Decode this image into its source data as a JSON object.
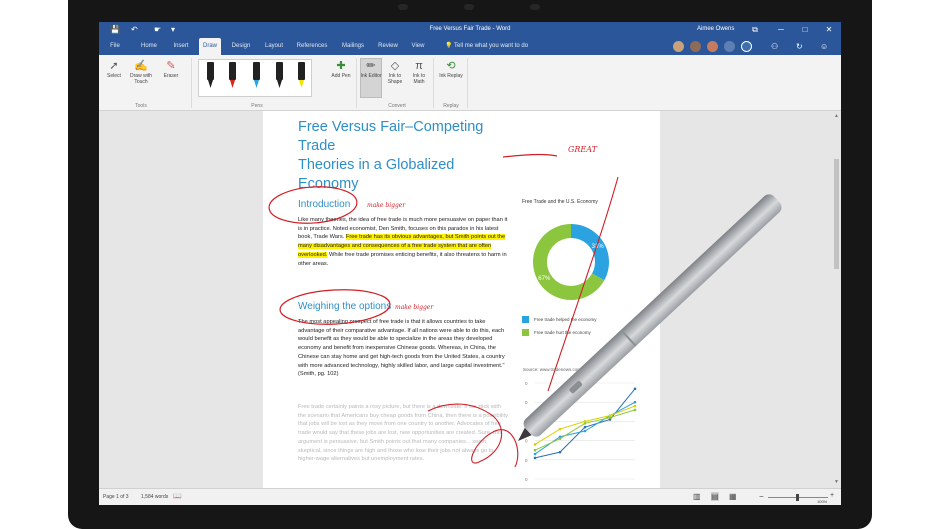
{
  "window": {
    "title": "Free Versus Fair Trade - Word",
    "user": "Aimee Owens",
    "quick_access": {
      "save": "💾",
      "undo": "↶",
      "touch": "☛",
      "more": "▾"
    },
    "controls": {
      "restore": "⧉",
      "minimize": "─",
      "maximize": "□",
      "close": "✕"
    }
  },
  "tabs": [
    {
      "label": "File"
    },
    {
      "label": "Home"
    },
    {
      "label": "Insert"
    },
    {
      "label": "Draw"
    },
    {
      "label": "Design"
    },
    {
      "label": "Layout"
    },
    {
      "label": "References"
    },
    {
      "label": "Mailings"
    },
    {
      "label": "Review"
    },
    {
      "label": "View"
    }
  ],
  "tell_me": {
    "icon": "💡",
    "text": "Tell me what you want to do"
  },
  "ribbon": {
    "select": "Select",
    "draw_touch": "Draw with Touch",
    "eraser": "Eraser",
    "add_pen": "Add Pen",
    "ink_editor": "Ink Editor",
    "ink_to_shape": "Ink to Shape",
    "ink_to_math": "Ink to Math",
    "replay": "Ink Replay",
    "groups": {
      "tools": "Tools",
      "pens": "Pens",
      "convert": "Convert",
      "replay": "Replay"
    },
    "pen_colors": [
      "#222222",
      "#d9251c",
      "#2aa3e0",
      "#222222",
      "#f2e600"
    ]
  },
  "document": {
    "title_line1": "Free Versus Fair–Competing Trade",
    "title_line2": "Theories in a Globalized Economy",
    "intro_heading": "Introduction",
    "intro_p1": "Like many theories, the idea of free trade is much more persuasive on paper than it is in practice. Noted economist, Den Smith, focuses on this paradox in his latest book, Trade Wars.",
    "intro_hl": "Free trade has its obvious advantages, but Smith points out the many disadvantages and consequences of a free trade system that are often overlooked.",
    "intro_p2": "While free trade promises enticing benefits, it also threatens to harm in other areas.",
    "options_heading": "Weighing the options",
    "options_p": "The most appealing prospect of free trade is that it allows countries to take advantage of their comparative advantage. If all nations were able to do this, each would benefit as they would be able to specialize in the areas they developed economy and benefit from inexpensive Chinese goods. Whereas, in China, the Chinese can stay home and get high-tech goods from the United States, a country with more advanced technology, highly skilled labor, and large capital investment.\" (Smith, pg. 102)",
    "faded_p": "Free trade certainly paints a rosy picture, but there is a downside. If we stick with the scenario that Americans buy cheap goods from China, then there is a possibility that jobs will be lost as they move from one country to another. Advocates of free trade would say that these jobs are lost, new opportunities are created. Sure, this argument is persuasive, but Smith points out that many companies... seem skeptical, since things are high and those who lose their jobs not always go to higher-wage alternatives but unemployment rates.",
    "ink": {
      "great": "GREAT",
      "make_bigger_1": "make bigger",
      "make_bigger_2": "make bigger"
    }
  },
  "chart_data": [
    {
      "type": "pie",
      "title": "Free Trade and the U.S. Economy",
      "slices": [
        {
          "label": "Free trade helped the economy",
          "value": 33,
          "display": "33%",
          "color": "#2aa3e0"
        },
        {
          "label": "Free trade hurt the economy",
          "value": 67,
          "display": "67%",
          "color": "#8cc63f"
        }
      ],
      "legend": "bottom"
    },
    {
      "type": "line",
      "source": "Source: www.tradenews.com",
      "y_ticks": [
        "0",
        "0",
        "0",
        "0",
        "0",
        "0"
      ],
      "x": [
        0,
        1,
        2,
        3,
        4
      ],
      "ylim": [
        0,
        5
      ],
      "series": [
        {
          "color": "#2a6fb5",
          "values": [
            1.1,
            1.4,
            2.7,
            3.1,
            4.7
          ]
        },
        {
          "color": "#2aa3e0",
          "values": [
            1.3,
            2.2,
            2.5,
            3.3,
            4.0
          ]
        },
        {
          "color": "#8cc63f",
          "values": [
            1.5,
            2.1,
            2.9,
            3.2,
            3.6
          ]
        },
        {
          "color": "#d9d200",
          "values": [
            1.8,
            2.6,
            3.0,
            3.3,
            3.8
          ]
        }
      ]
    }
  ],
  "status": {
    "page": "Page 1 of 3",
    "words": "1,584 words",
    "proof_icon": "📖",
    "zoom": "100%",
    "zoom_minus": "−",
    "zoom_plus": "+"
  },
  "colors": {
    "accent": "#2b579a",
    "heading": "#2e8fc7",
    "ink": "#d21f26",
    "highlight": "#fff200"
  }
}
